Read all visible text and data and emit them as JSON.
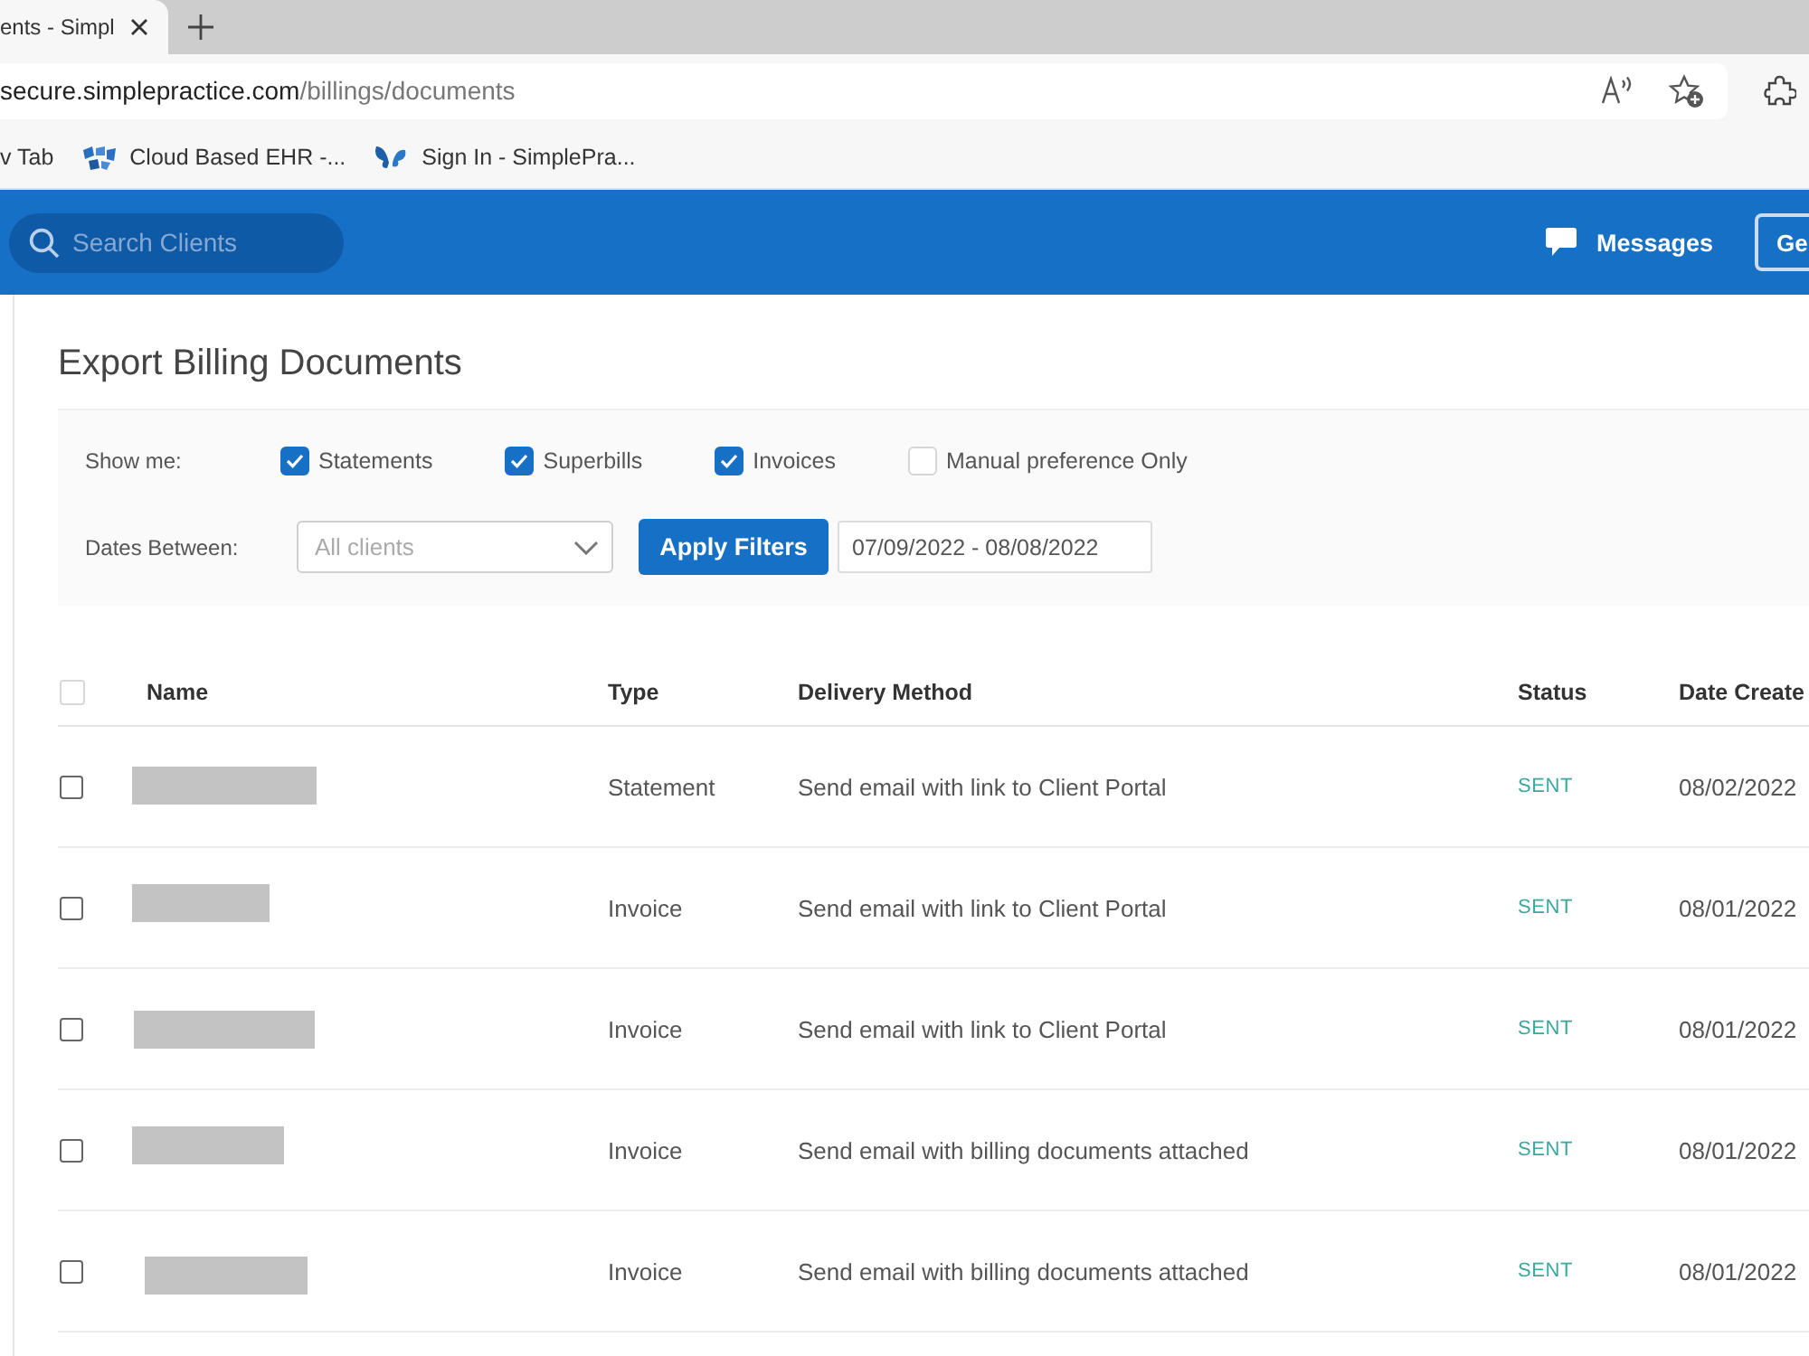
{
  "browser": {
    "tabs": [
      {
        "title": "ents - Simpl",
        "selected": true
      }
    ],
    "address_bar": {
      "host": "secure.simplepractice.com",
      "path": "/billings/documents"
    },
    "bookmarks": [
      {
        "label": "v Tab"
      },
      {
        "label": "Cloud Based EHR -..."
      },
      {
        "label": "Sign In - SimplePra..."
      }
    ]
  },
  "navbar": {
    "search": {
      "placeholder": "Search Clients"
    },
    "messages": "Messages",
    "button": "Ge"
  },
  "page": {
    "title": "Export Billing Documents"
  },
  "filters": {
    "show_me": {
      "label": "Show me:",
      "options": [
        {
          "label": "Statements",
          "checked": true
        },
        {
          "label": "Superbills",
          "checked": true
        },
        {
          "label": "Invoices",
          "checked": true
        },
        {
          "label": "Manual preference Only",
          "checked": false
        }
      ]
    },
    "dates": {
      "label": "Dates Between:",
      "client_select": {
        "placeholder": "All clients"
      },
      "apply_button": "Apply Filters",
      "date_range": {
        "value": "07/09/2022 - 08/08/2022"
      }
    }
  },
  "table": {
    "select_all": {
      "checked": false,
      "disabled": true
    },
    "columns": [
      "Name",
      "Type",
      "Delivery Method",
      "Status",
      "Date Create"
    ],
    "rows": [
      {
        "checked": false,
        "name_redacted": true,
        "type": "Statement",
        "delivery_method": "Send email with link to Client Portal",
        "status": "SENT",
        "date": "08/02/2022"
      },
      {
        "checked": false,
        "name_redacted": true,
        "type": "Invoice",
        "delivery_method": "Send email with link to Client Portal",
        "status": "SENT",
        "date": "08/01/2022"
      },
      {
        "checked": false,
        "name_redacted": true,
        "type": "Invoice",
        "delivery_method": "Send email with link to Client Portal",
        "status": "SENT",
        "date": "08/01/2022"
      },
      {
        "checked": false,
        "name_redacted": true,
        "type": "Invoice",
        "delivery_method": "Send email with billing documents attached",
        "status": "SENT",
        "date": "08/01/2022"
      },
      {
        "checked": false,
        "name_redacted": true,
        "type": "Invoice",
        "delivery_method": "Send email with billing documents attached",
        "status": "SENT",
        "date": "08/01/2022"
      }
    ]
  }
}
